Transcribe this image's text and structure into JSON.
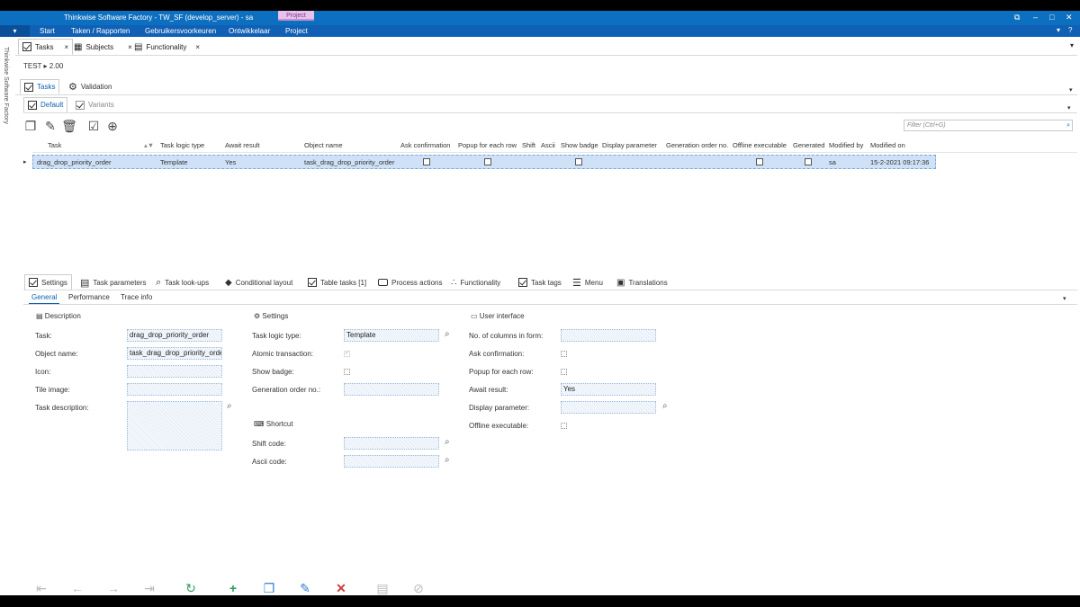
{
  "window": {
    "title": "Thinkwise Software Factory - TW_SF (develop_server) - sa",
    "context_tab": "Project"
  },
  "menu": {
    "app_button": "▾",
    "items": [
      "Start",
      "Taken / Rapporten",
      "Gebruikersvoorkeuren",
      "Ontwikkelaar",
      "Project"
    ]
  },
  "side_label": "Thinkwise Software Factory",
  "doc_tabs": [
    {
      "label": "Tasks",
      "close": "×"
    },
    {
      "label": "Subjects",
      "close": "×"
    },
    {
      "label": "Functionality",
      "close": "×"
    }
  ],
  "breadcrumb": "TEST ▸ 2.00",
  "main_tabs": [
    "Tasks",
    "Validation"
  ],
  "variant_tabs": [
    "Default",
    "Variants"
  ],
  "filter": {
    "placeholder": "Filter (Ctrl+G)"
  },
  "grid": {
    "columns": [
      "Task",
      "Task logic type",
      "Await result",
      "Object name",
      "Ask confirmation",
      "Popup for each row",
      "Shift",
      "Ascii",
      "Show badge",
      "Display parameter",
      "Generation order no.",
      "Offline executable",
      "Generated",
      "Modified by",
      "Modified on"
    ],
    "rows": [
      {
        "task": "drag_drop_priority_order",
        "logic_type": "Template",
        "await": "Yes",
        "object": "task_drag_drop_priority_order",
        "modified_by": "sa",
        "modified_on": "15-2-2021 09:17:36"
      }
    ]
  },
  "detail_tabs": [
    "Settings",
    "Task parameters",
    "Task look-ups",
    "Conditional layout",
    "Table tasks [1]",
    "Process actions",
    "Functionality",
    "Task tags",
    "Menu",
    "Translations"
  ],
  "sub_tabs": [
    "General",
    "Performance",
    "Trace info"
  ],
  "form": {
    "description": {
      "header": "Description",
      "task_label": "Task:",
      "task_value": "drag_drop_priority_order",
      "object_label": "Object name:",
      "object_value": "task_drag_drop_priority_order",
      "icon_label": "Icon:",
      "tile_label": "Tile image:",
      "desc_label": "Task description:"
    },
    "settings": {
      "header": "Settings",
      "logic_label": "Task logic type:",
      "logic_value": "Template",
      "atomic_label": "Atomic transaction:",
      "badge_label": "Show badge:",
      "genorder_label": "Generation order no.:"
    },
    "shortcut": {
      "header": "Shortcut",
      "shift_label": "Shift code:",
      "ascii_label": "Ascii code:"
    },
    "ui": {
      "header": "User interface",
      "cols_label": "No. of columns in form:",
      "ask_label": "Ask confirmation:",
      "popup_label": "Popup for each row:",
      "await_label": "Await result:",
      "await_value": "Yes",
      "display_label": "Display parameter:",
      "offline_label": "Offline executable:"
    }
  }
}
